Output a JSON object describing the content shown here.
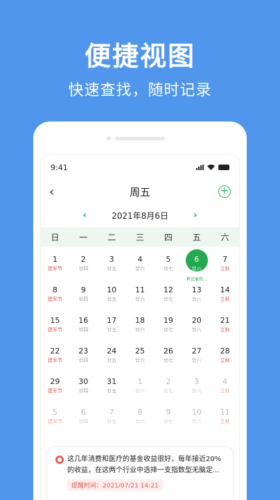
{
  "hero": {
    "title": "便捷视图",
    "subtitle": "快速查找，随时记录"
  },
  "status": {
    "time": "9:41"
  },
  "nav": {
    "back": "‹",
    "title": "周五",
    "add": "+"
  },
  "month": {
    "prev": "‹",
    "label": "2021年8月6日",
    "next": "›"
  },
  "weekdays": [
    "日",
    "一",
    "二",
    "三",
    "四",
    "五",
    "六"
  ],
  "weeks": [
    [
      {
        "n": "1",
        "l": "建军节",
        "red": true
      },
      {
        "n": "2",
        "l": "廿四"
      },
      {
        "n": "3",
        "l": "廿五"
      },
      {
        "n": "4",
        "l": "廿六"
      },
      {
        "n": "5",
        "l": "廿七"
      },
      {
        "n": "6",
        "l": "廿八",
        "today": true,
        "tag": "有记录的..."
      },
      {
        "n": "7",
        "l": "立秋",
        "red": true
      }
    ],
    [
      {
        "n": "8",
        "l": "建军节",
        "red": true
      },
      {
        "n": "9",
        "l": "廿四"
      },
      {
        "n": "10",
        "l": "廿五"
      },
      {
        "n": "11",
        "l": "廿六"
      },
      {
        "n": "12",
        "l": "廿七"
      },
      {
        "n": "13",
        "l": "廿八"
      },
      {
        "n": "14",
        "l": "立秋",
        "red": true
      }
    ],
    [
      {
        "n": "15",
        "l": "建军节",
        "red": true
      },
      {
        "n": "16",
        "l": "廿四"
      },
      {
        "n": "17",
        "l": "廿五"
      },
      {
        "n": "18",
        "l": "廿六"
      },
      {
        "n": "19",
        "l": "廿七"
      },
      {
        "n": "20",
        "l": "廿八"
      },
      {
        "n": "21",
        "l": "立秋",
        "red": true
      }
    ],
    [
      {
        "n": "22",
        "l": "建军节",
        "red": true
      },
      {
        "n": "23",
        "l": "廿四"
      },
      {
        "n": "24",
        "l": "廿五"
      },
      {
        "n": "25",
        "l": "廿六"
      },
      {
        "n": "26",
        "l": "廿七"
      },
      {
        "n": "27",
        "l": "廿八"
      },
      {
        "n": "28",
        "l": "立秋",
        "red": true
      }
    ],
    [
      {
        "n": "29",
        "l": "建军节",
        "red": true
      },
      {
        "n": "30",
        "l": "廿四"
      },
      {
        "n": "31",
        "l": "廿五"
      },
      {
        "n": "1",
        "l": "廿六",
        "dim": true
      },
      {
        "n": "2",
        "l": "廿七",
        "dim": true
      },
      {
        "n": "3",
        "l": "廿八",
        "dim": true
      },
      {
        "n": "4",
        "l": "立秋",
        "red": true,
        "dim": true
      }
    ],
    [
      {
        "n": "5",
        "l": "建军节",
        "red": true,
        "dim": true
      },
      {
        "n": "6",
        "l": "廿四",
        "dim": true
      },
      {
        "n": "7",
        "l": "廿五",
        "dim": true
      },
      {
        "n": "8",
        "l": "廿六",
        "dim": true
      },
      {
        "n": "9",
        "l": "廿七",
        "dim": true
      },
      {
        "n": "10",
        "l": "廿八",
        "dim": true
      },
      {
        "n": "11",
        "l": "立秋",
        "red": true,
        "dim": true
      }
    ]
  ],
  "note": {
    "text": "这几年消费和医疗的基金收益很好，每年接近20%的收益，在这两个行业中选择一支指数型无脑定...",
    "remind": "提醒时间：2021/07/21 14:21"
  },
  "colors": {
    "bg": "#4f96ec",
    "accent": "#23a94f",
    "festival": "#e25b55"
  }
}
